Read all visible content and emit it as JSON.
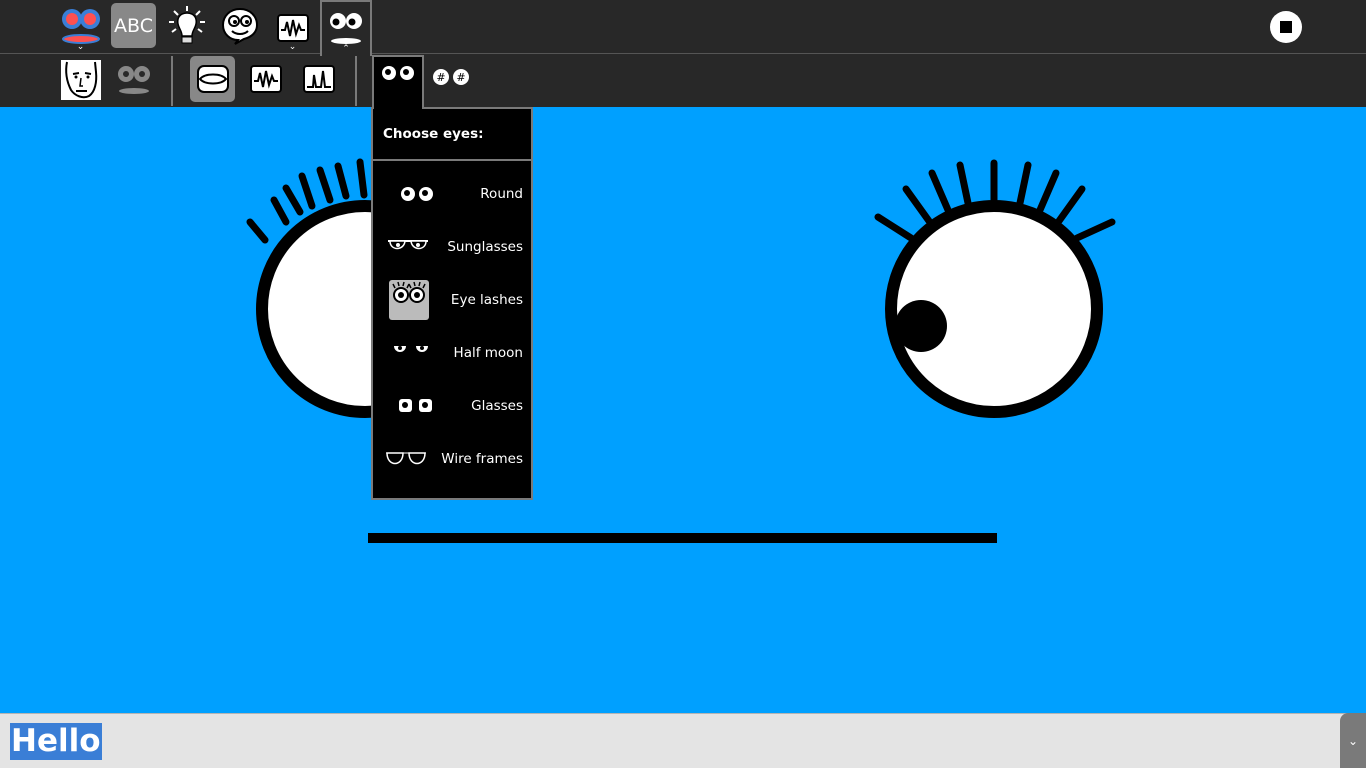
{
  "toolbar": {
    "abc_label": "ABC",
    "icons": [
      "mouth-eyes-activity-icon",
      "abc-icon",
      "lightbulb-icon",
      "speech-face-icon",
      "waveform-icon",
      "face-icon",
      "stop-icon"
    ]
  },
  "subtoolbar": {
    "icons": [
      "face-photo-icon",
      "eyes-mouth-icon",
      "mouth-icon",
      "waveform-icon",
      "spectrum-icon"
    ]
  },
  "palette": {
    "tab_icons": [
      "eyes-icon",
      "hash-eyes-icon"
    ],
    "header": "Choose eyes:",
    "items": [
      {
        "label": "Round",
        "icon": "round-eyes-icon"
      },
      {
        "label": "Sunglasses",
        "icon": "sunglasses-icon"
      },
      {
        "label": "Eye lashes",
        "icon": "eye-lashes-icon"
      },
      {
        "label": "Half moon",
        "icon": "half-moon-eyes-icon"
      },
      {
        "label": "Glasses",
        "icon": "glasses-icon"
      },
      {
        "label": "Wire frames",
        "icon": "wire-frames-icon"
      }
    ]
  },
  "entry": {
    "value": "Hello"
  },
  "colors": {
    "background": "#00a0ff",
    "toolbar": "#282828",
    "palette": "#000000",
    "selection": "#3a7ed6"
  }
}
